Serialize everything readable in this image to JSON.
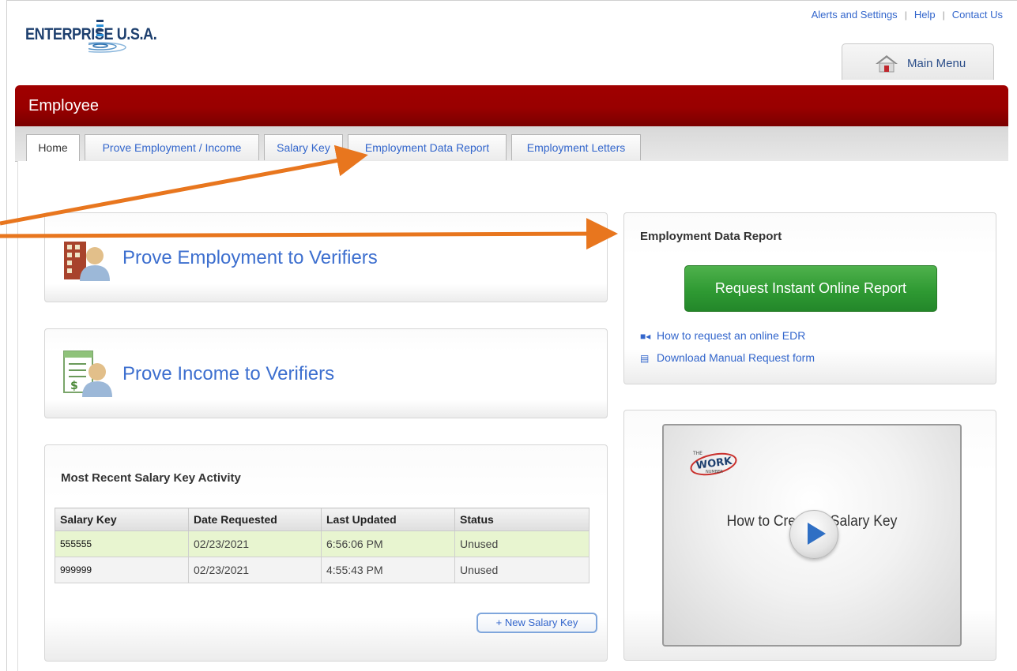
{
  "brand": {
    "logo_text": "ENTERPRISE U.S.A."
  },
  "top_links": [
    "Alerts and Settings",
    "Help",
    "Contact Us"
  ],
  "main_menu": {
    "label": "Main Menu"
  },
  "header": {
    "title": "Employee"
  },
  "tabs": [
    {
      "label": "Home",
      "active": true
    },
    {
      "label": "Prove Employment / Income",
      "active": false
    },
    {
      "label": "Salary Key",
      "active": false
    },
    {
      "label": "Employment Data Report",
      "active": false
    },
    {
      "label": "Employment Letters",
      "active": false
    }
  ],
  "prove_employment": {
    "title": "Prove Employment to Verifiers"
  },
  "prove_income": {
    "title": "Prove Income to Verifiers"
  },
  "salary_key_activity": {
    "title": "Most Recent Salary Key Activity",
    "columns": [
      "Salary Key",
      "Date Requested",
      "Last Updated",
      "Status"
    ],
    "rows": [
      {
        "key": "555555",
        "date": "02/23/2021",
        "updated": "6:56:06 PM",
        "status": "Unused",
        "highlighted": true
      },
      {
        "key": "999999",
        "date": "02/23/2021",
        "updated": "4:55:43 PM",
        "status": "Unused",
        "highlighted": false
      }
    ],
    "new_button": "+ New Salary Key"
  },
  "edr": {
    "title": "Employment Data Report",
    "button": "Request Instant Online Report",
    "links": [
      {
        "icon": "video-camera-icon",
        "label": "How to request an online EDR"
      },
      {
        "icon": "form-icon",
        "label": "Download Manual Request form"
      }
    ]
  },
  "video": {
    "title": "How to Create a Salary Key",
    "logo": "THE WORK NUMBER"
  },
  "colors": {
    "header_red": "#990000",
    "link_blue": "#3366cc",
    "accent_green": "#2f9a33",
    "annotation_orange": "#e8761e",
    "row_highlight": "#e8f5d0"
  }
}
